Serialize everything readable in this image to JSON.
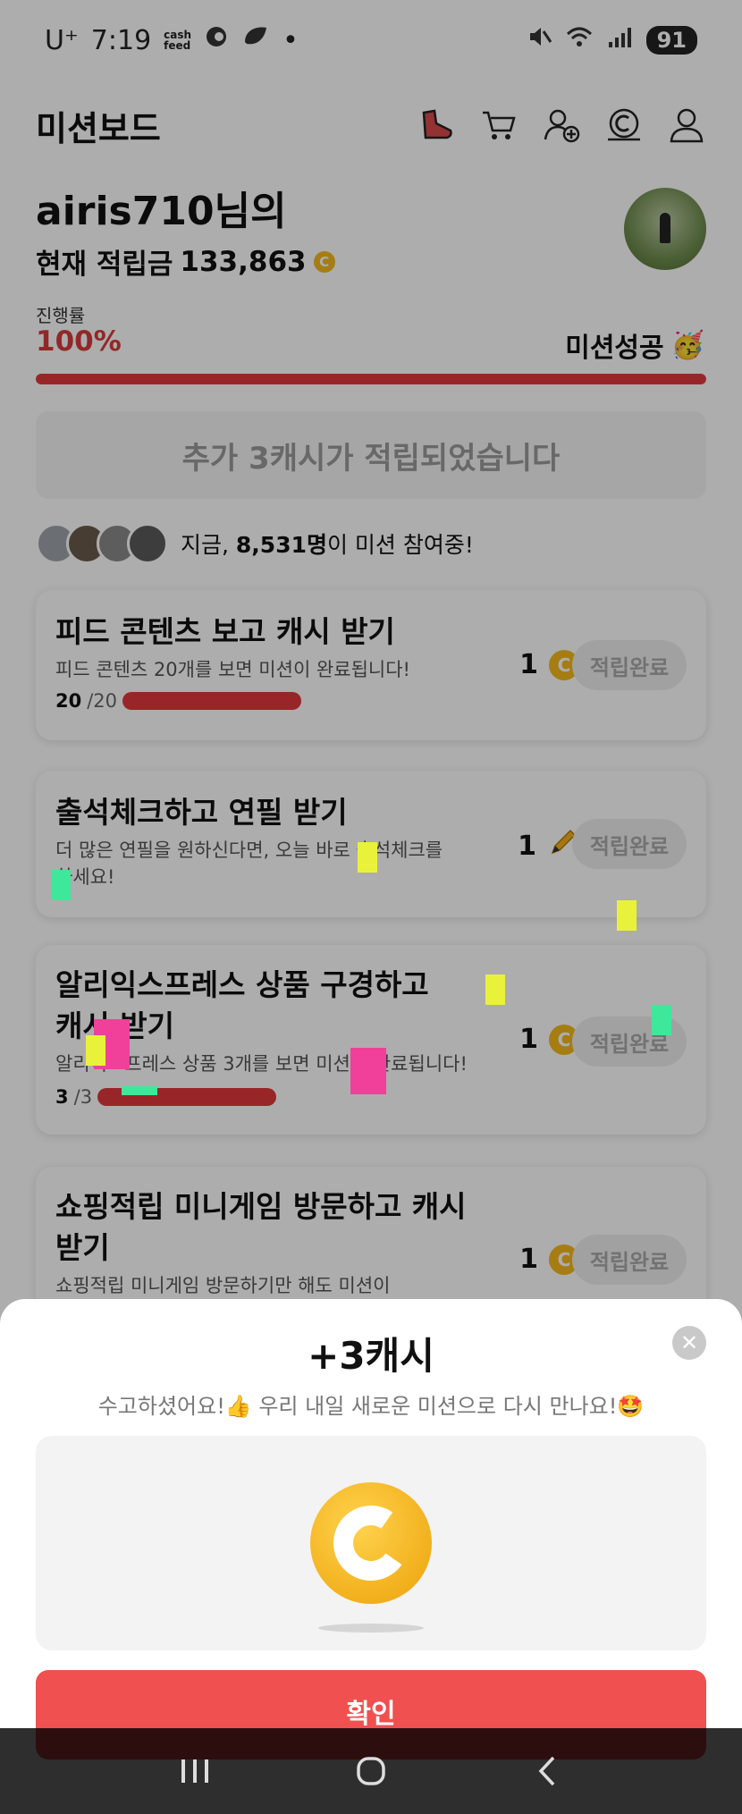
{
  "status_bar": {
    "carrier": "U⁺",
    "time": "7:19",
    "app_badge_top": "cash",
    "app_badge_bottom": "feed",
    "battery": "91"
  },
  "header": {
    "title": "미션보드",
    "icons": [
      "shoe-icon",
      "cart-icon",
      "add-friend-icon",
      "coin-icon",
      "profile-icon"
    ]
  },
  "profile": {
    "username": "airis710님의",
    "balance_label": "현재 적립금",
    "balance_value": "133,863",
    "coin_symbol": "C"
  },
  "progress": {
    "label": "진행률",
    "value_text": "100%",
    "fraction": 1.0,
    "status": "미션성공",
    "status_emoji": "🥳"
  },
  "notice": "추가 3캐시가 적립되었습니다",
  "participants": {
    "prefix": "지금,",
    "count": "8,531명",
    "suffix": "이 미션 참여중!"
  },
  "missions": [
    {
      "title": "피드 콘텐츠 보고 캐시 받기",
      "desc": "피드 콘텐츠 20개를 보면 미션이 완료됩니다!",
      "done": "20",
      "total": "/20",
      "reward": "1",
      "reward_icon": "coin-icon",
      "button": "적립완료"
    },
    {
      "title": "출석체크하고 연필 받기",
      "desc_line1": "더 많은 연필을 원하신다면, 오늘 바로 출석체크를",
      "desc_line2": "하세요!",
      "reward": "1",
      "reward_icon": "pencil-icon",
      "button": "적립완료"
    },
    {
      "title_line1": "알리익스프레스 상품 구경하고",
      "title_line2": "캐시 받기",
      "desc": "알리익스프레스 상품 3개를 보면 미션이 완료됩니다!",
      "done": "3",
      "total": "/3",
      "reward": "1",
      "reward_icon": "coin-icon",
      "button": "적립완료"
    },
    {
      "title_line1": "쇼핑적립 미니게임 방문하고 캐시",
      "title_line2": "받기",
      "desc": "쇼핑적립 미니게임 방문하기만 해도 미션이",
      "reward": "1",
      "reward_icon": "coin-icon",
      "button": "적립완료"
    }
  ],
  "sheet": {
    "amount": "+3캐시",
    "message": "수고하셨어요!👍 우리 내일 새로운 미션으로 다시 만나요!🤩",
    "confirm": "확인"
  },
  "colors": {
    "accent": "#e0393b",
    "confirm": "#f05050",
    "coin": "#f3b91d"
  }
}
